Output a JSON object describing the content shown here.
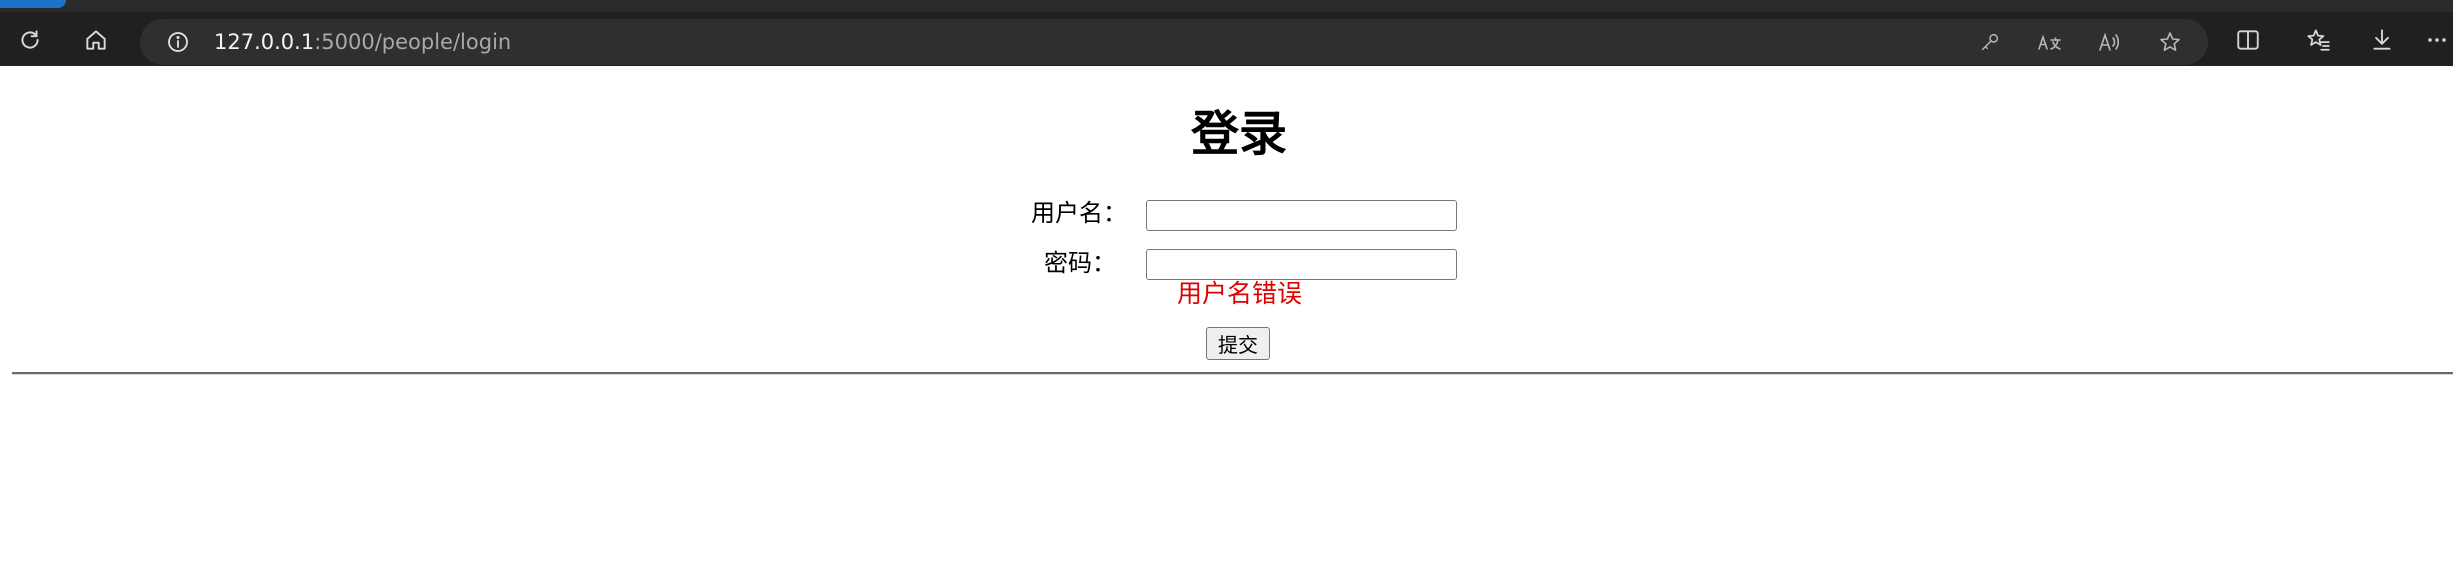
{
  "browser": {
    "url_host": "127.0.0.1",
    "url_rest": ":5000/people/login",
    "icons": {
      "refresh": "refresh-icon",
      "home": "home-icon",
      "site_info": "info-icon",
      "password": "key-icon",
      "translate": "translate-icon",
      "read_aloud": "read-aloud-icon",
      "favorite": "star-icon",
      "split_screen": "split-screen-icon",
      "favorites": "favorites-icon",
      "downloads": "download-icon",
      "more": "more-icon"
    }
  },
  "page": {
    "title": "登录",
    "form": {
      "username_label": "用户名：",
      "username_value": "",
      "password_label": "密码：",
      "password_value": "",
      "error": "用户名错误",
      "submit_label": "提交"
    }
  },
  "colors": {
    "error": "#e00000",
    "chrome_background": "#202020",
    "address_bar": "#2f2f2f"
  }
}
